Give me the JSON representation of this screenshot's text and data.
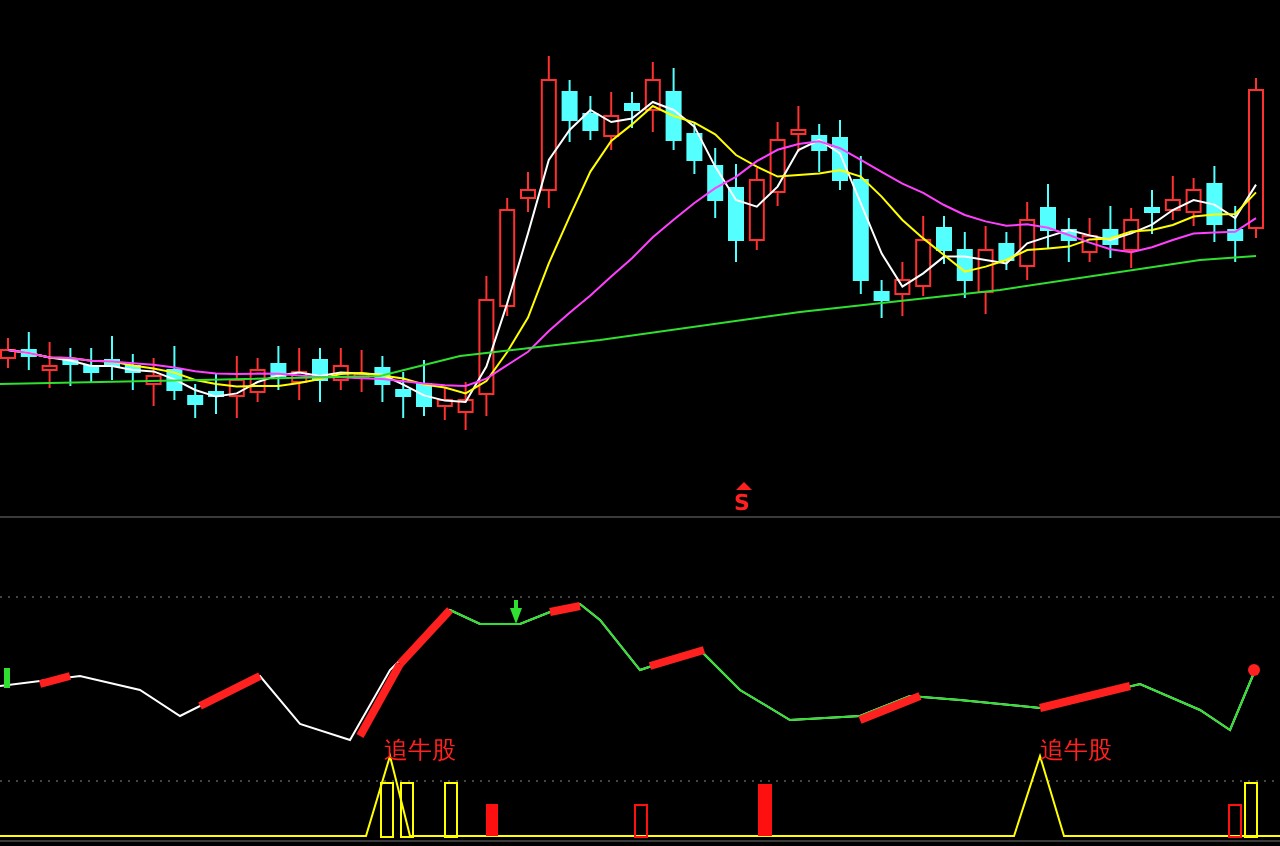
{
  "signal_mark": {
    "text": "S"
  },
  "bottom_labels": [
    {
      "text": "追牛股"
    },
    {
      "text": "追牛股"
    }
  ]
}
